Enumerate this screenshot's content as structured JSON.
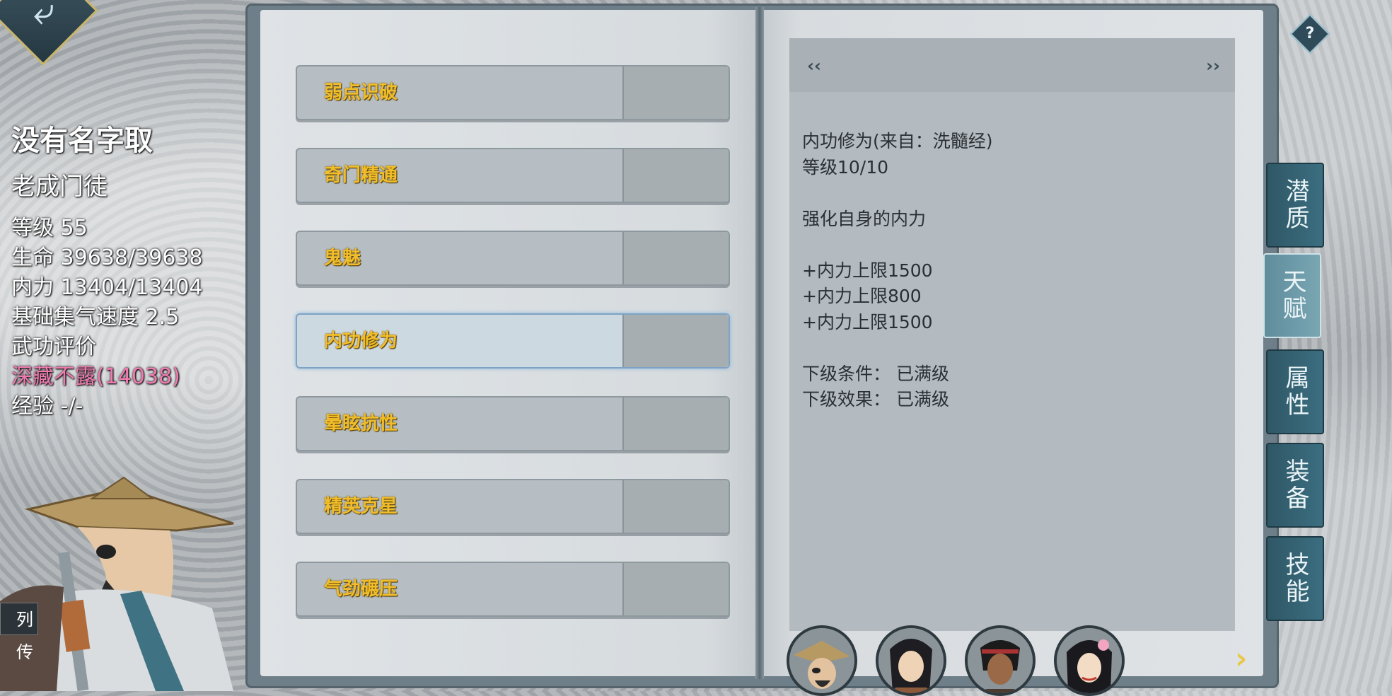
{
  "character": {
    "name": "没有名字取",
    "title": "老成门徒",
    "stats": [
      "等级 55",
      "生命 39638/39638",
      "内力 13404/13404",
      "基础集气速度 2.5",
      "武功评价",
      "深藏不露(14038)",
      "经验 -/-"
    ],
    "biography_tab": "列传"
  },
  "talents": [
    {
      "name": "弱点识破"
    },
    {
      "name": "奇门精通"
    },
    {
      "name": "鬼魅"
    },
    {
      "name": "内功修为"
    },
    {
      "name": "晕眩抗性"
    },
    {
      "name": "精英克星"
    },
    {
      "name": "气劲碾压"
    }
  ],
  "selected_talent": "内功修为",
  "detail": {
    "lines": [
      "内功修为(来自：洗髓经)",
      "等级10/10",
      "",
      "强化自身的内力",
      "",
      "+内力上限1500",
      "+内力上限800",
      "+内力上限1500",
      "",
      "下级条件： 已满级",
      "下级效果： 已满级"
    ],
    "prev_icon": "chevron-left-icon",
    "next_icon": "chevron-right-icon"
  },
  "side_tabs": [
    {
      "label": "潜质"
    },
    {
      "label": "天赋"
    },
    {
      "label": "属性"
    },
    {
      "label": "装备"
    },
    {
      "label": "技能"
    }
  ],
  "active_side_tab": "天赋",
  "help_label": "?",
  "colors": {
    "talent_name": "#f1bd2a",
    "highlight_stat": "#f07ab0",
    "side_tab": "#3b6e80"
  }
}
